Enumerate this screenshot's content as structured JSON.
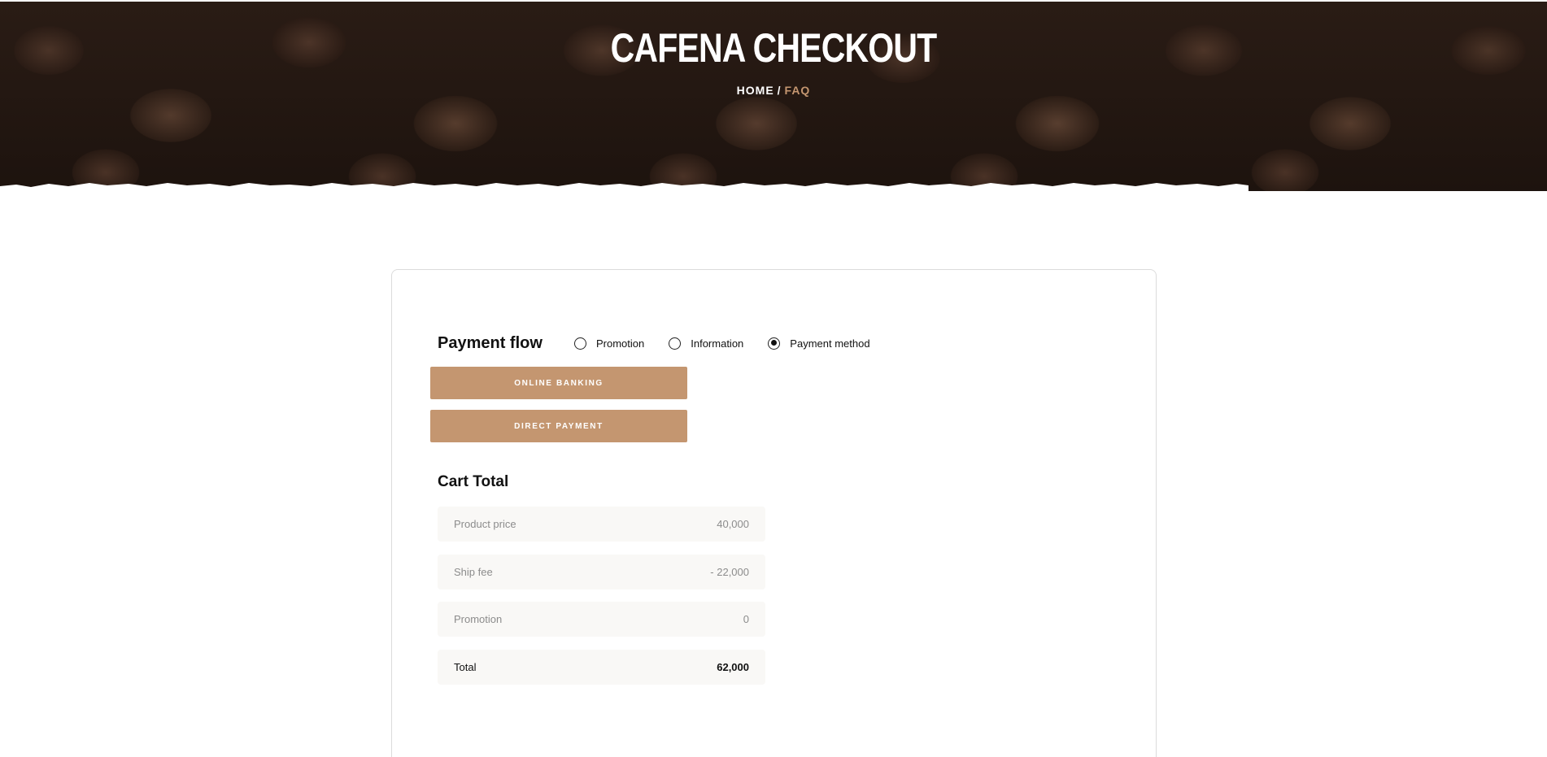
{
  "hero": {
    "title": "CAFENA CHECKOUT",
    "breadcrumb": {
      "home": "HOME",
      "separator": "/",
      "current": "FAQ"
    }
  },
  "payment_flow": {
    "title": "Payment flow",
    "options": [
      {
        "label": "Promotion",
        "checked": false
      },
      {
        "label": "Information",
        "checked": false
      },
      {
        "label": "Payment method",
        "checked": true
      }
    ]
  },
  "payment_buttons": {
    "online_banking": "ONLINE BANKING",
    "direct_payment": "DIRECT PAYMENT"
  },
  "cart_total": {
    "title": "Cart Total",
    "rows": [
      {
        "label": "Product price",
        "value": "40,000"
      },
      {
        "label": "Ship fee",
        "value": "- 22,000"
      },
      {
        "label": "Promotion",
        "value": "0"
      },
      {
        "label": "Total",
        "value": "62,000"
      }
    ]
  },
  "colors": {
    "accent": "#c49670",
    "hero_dark": "#2a1c15",
    "row_bg": "#f9f8f6",
    "muted_text": "#8c8c8c"
  }
}
